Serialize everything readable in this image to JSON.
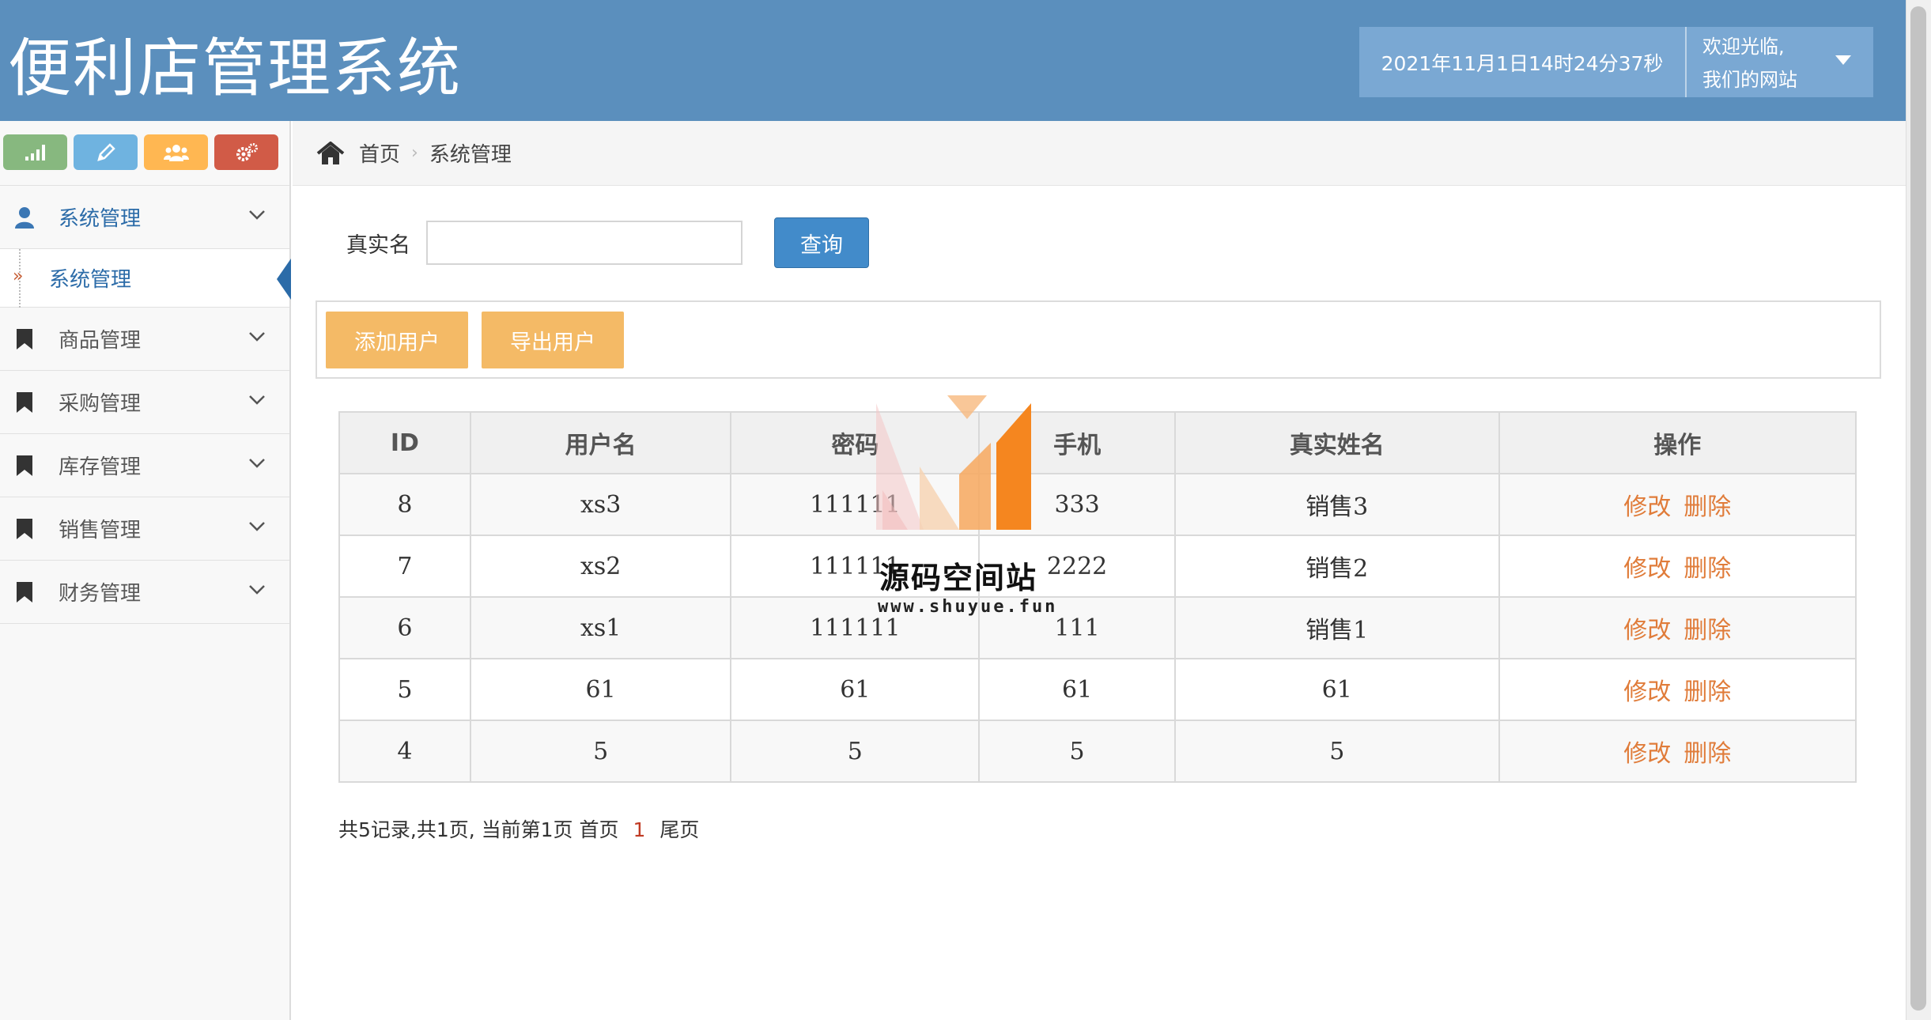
{
  "header": {
    "title": "便利店管理系统",
    "datetime": "2021年11月1日14时24分37秒",
    "welcome_line1": "欢迎光临,",
    "welcome_line2": "我们的网站"
  },
  "sidebar": {
    "shortcuts": [
      {
        "icon": "signal-icon",
        "color": "#87b87f"
      },
      {
        "icon": "pencil-icon",
        "color": "#6fb3e0"
      },
      {
        "icon": "users-icon",
        "color": "#ffb752"
      },
      {
        "icon": "cogs-icon",
        "color": "#d15b47"
      }
    ],
    "items": [
      {
        "label": "系统管理",
        "icon": "user-icon",
        "active": true
      },
      {
        "label": "商品管理",
        "icon": "bookmark-icon"
      },
      {
        "label": "采购管理",
        "icon": "bookmark-icon"
      },
      {
        "label": "库存管理",
        "icon": "bookmark-icon"
      },
      {
        "label": "销售管理",
        "icon": "bookmark-icon"
      },
      {
        "label": "财务管理",
        "icon": "bookmark-icon"
      }
    ],
    "submenu": {
      "label": "系统管理"
    }
  },
  "breadcrumb": {
    "home": "首页",
    "current": "系统管理"
  },
  "search": {
    "label": "真实名",
    "value": "",
    "button": "查询"
  },
  "toolbar": {
    "add": "添加用户",
    "export": "导出用户"
  },
  "table": {
    "headers": [
      "ID",
      "用户名",
      "密码",
      "手机",
      "真实姓名",
      "操作"
    ],
    "rows": [
      {
        "id": "8",
        "username": "xs3",
        "password": "111111",
        "phone": "333",
        "realname": "销售3"
      },
      {
        "id": "7",
        "username": "xs2",
        "password": "111111",
        "phone": "2222",
        "realname": "销售2"
      },
      {
        "id": "6",
        "username": "xs1",
        "password": "111111",
        "phone": "111",
        "realname": "销售1"
      },
      {
        "id": "5",
        "username": "61",
        "password": "61",
        "phone": "61",
        "realname": "61"
      },
      {
        "id": "4",
        "username": "5",
        "password": "5",
        "phone": "5",
        "realname": "5"
      }
    ],
    "edit": "修改",
    "delete": "删除"
  },
  "pagination": {
    "summary": "共5记录,共1页, 当前第1页",
    "first": "首页",
    "current": "1",
    "last": "尾页"
  },
  "watermark": {
    "name": "源码空间站",
    "url": "www.shuyue.fun"
  }
}
